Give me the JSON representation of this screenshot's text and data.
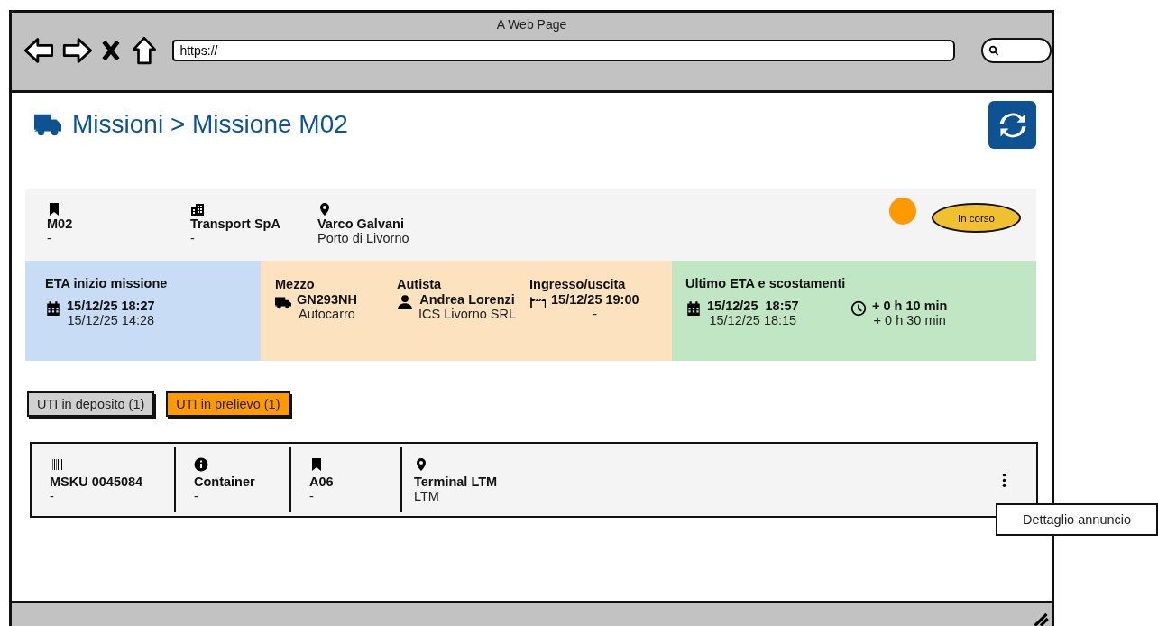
{
  "window": {
    "title": "A Web Page",
    "url": "https://"
  },
  "breadcrumb": "Missioni > Missione M02",
  "header_fields": [
    {
      "kind": "bookmark",
      "main": "M02",
      "sub": "-"
    },
    {
      "kind": "building",
      "main": "Transport SpA",
      "sub": "-"
    },
    {
      "kind": "pin",
      "main": "Varco Galvani",
      "sub": "Porto di Livorno"
    }
  ],
  "status": {
    "color": "#ff9900",
    "badge": "In corso"
  },
  "panels": [
    {
      "color": "#c9dcf6",
      "title": "ETA inizio missione",
      "columns": [
        {
          "kind": "calendar",
          "main": "15/12/25 18:27",
          "sub": "15/12/25 14:28"
        }
      ]
    },
    {
      "color": "#fde2c0",
      "columns": [
        {
          "title": "Mezzo",
          "kind": "truck",
          "main": "GN293NH",
          "sub": "Autocarro"
        },
        {
          "title": "Autista",
          "kind": "person",
          "main": "Andrea Lorenzi",
          "sub": "ICS Livorno SRL"
        },
        {
          "title": "Ingresso/uscita",
          "kind": "barrier",
          "main": "15/12/25 19:00",
          "sub": "-"
        }
      ]
    },
    {
      "color": "#c0e6c4",
      "title": "Ultimo ETA e scostamenti",
      "columns": [
        {
          "kind": "calendar",
          "main": "15/12/25  18:57",
          "sub": "15/12/25 18:15"
        },
        {
          "kind": "clock",
          "main": "+ 0 h 10 min",
          "sub": "+ 0 h 30 min"
        }
      ]
    }
  ],
  "tabs": [
    {
      "label": "UTI in deposito (1)",
      "selected": false
    },
    {
      "label": "UTI in prelievo (1)",
      "selected": true
    }
  ],
  "uti_rows": [
    {
      "fields": [
        {
          "kind": "barcode",
          "main": "MSKU 0045084",
          "sub": "-"
        },
        {
          "kind": "info",
          "main": "Container",
          "sub": "-"
        },
        {
          "kind": "bookmark",
          "main": "A06",
          "sub": "-"
        },
        {
          "kind": "pin",
          "main": "Terminal LTM",
          "sub": "LTM"
        }
      ],
      "menu": [
        "Dettaglio annuncio"
      ]
    }
  ]
}
